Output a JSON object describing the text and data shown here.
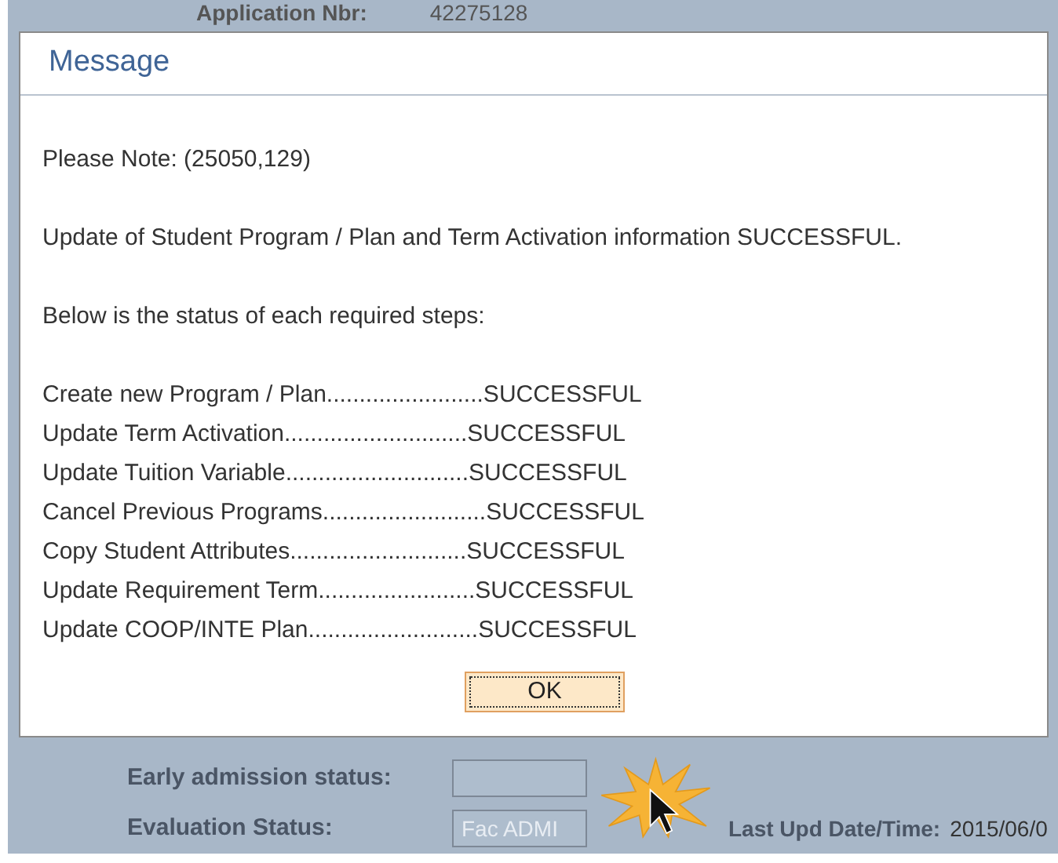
{
  "page": {
    "header_label": "Application Nbr:",
    "header_value": "42275128",
    "fields": [
      {
        "label": "Early admission status:"
      },
      {
        "label": "Evaluation Status:",
        "value": "Fac ADMI"
      }
    ],
    "last_update": {
      "label": "Last Upd Date/Time:",
      "value": "2015/06/0"
    }
  },
  "dialog": {
    "title": "Message",
    "note": "Please Note: (25050,129)",
    "summary": "Update of Student Program / Plan and Term Activation information SUCCESSFUL.",
    "intro": "Below is the status of each required steps:",
    "steps": [
      "Create new Program / Plan........................SUCCESSFUL",
      "Update Term Activation............................SUCCESSFUL",
      "Update Tuition Variable............................SUCCESSFUL",
      "Cancel Previous Programs.........................SUCCESSFUL",
      "Copy Student Attributes...........................SUCCESSFUL",
      "Update Requirement Term........................SUCCESSFUL",
      "Update COOP/INTE Plan..........................SUCCESSFUL"
    ],
    "button": "OK"
  }
}
